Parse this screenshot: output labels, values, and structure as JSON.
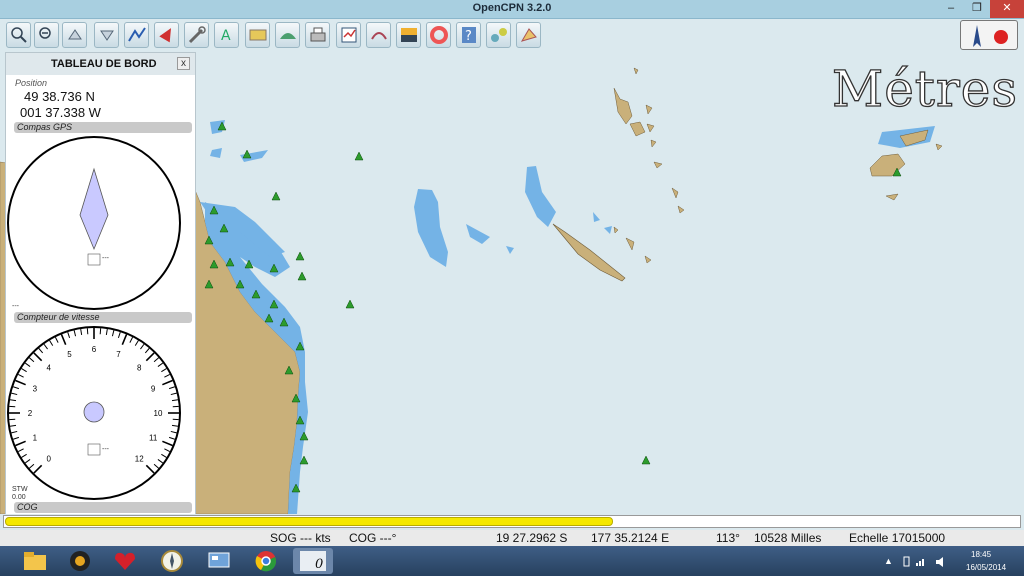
{
  "window": {
    "title": "OpenCPN 3.2.0",
    "min_glyph": "–",
    "max_glyph": "❐",
    "close_glyph": "✕"
  },
  "toolbar": {
    "tools": [
      "zoom-in-icon",
      "zoom-out-icon",
      "scale-icon",
      "route-icon",
      "boat-icon",
      "settings-icon",
      "anchor-text-icon",
      "chart-quilt-icon",
      "tide-icon",
      "print-icon",
      "chart-chooser-icon",
      "track-icon",
      "colour-scheme-icon",
      "lifebuoy-icon",
      "help-icon",
      "ais-icon",
      "grib-icon"
    ]
  },
  "chart_overlay": {
    "depth_units": "Métres"
  },
  "dashboard": {
    "title": "TABLEAU DE BORD",
    "close": "x",
    "position_label": "Position",
    "latitude": "49 38.736 N",
    "longitude": "001 37.338 W",
    "compass_label": "Compas GPS",
    "compass_value": "---",
    "compass_under": "---",
    "speed_label": "Compteur de vitesse",
    "speed_ticks": [
      "0",
      "1",
      "2",
      "3",
      "4",
      "5",
      "6",
      "7",
      "8",
      "9",
      "10",
      "11",
      "12"
    ],
    "speed_value": "---",
    "stw_label": "STW",
    "stw_value": "0.00",
    "cog_label": "COG",
    "cog_value": "---"
  },
  "progress": {
    "fraction": 0.6
  },
  "status": {
    "sog": "SOG --- kts",
    "cog": "COG ---°",
    "lat": "19 27.2962 S",
    "lon": "177 35.2124 E",
    "bearing": "113°",
    "distance": "10528 Milles",
    "scale": "Echelle 17015000"
  },
  "taskbar": {
    "apps": [
      "file-explorer-icon",
      "media-icon",
      "heart-app-icon",
      "opencpn-compass-icon",
      "control-panel-icon",
      "chrome-icon",
      "opencpn-app-icon"
    ],
    "time": "18:45",
    "date": "16/05/2014",
    "tray_up": "▲"
  },
  "colors": {
    "land": "#c9b07a",
    "shallow": "#74b3e6",
    "sea": "#dbe9ee",
    "accent": "#f4e800"
  }
}
